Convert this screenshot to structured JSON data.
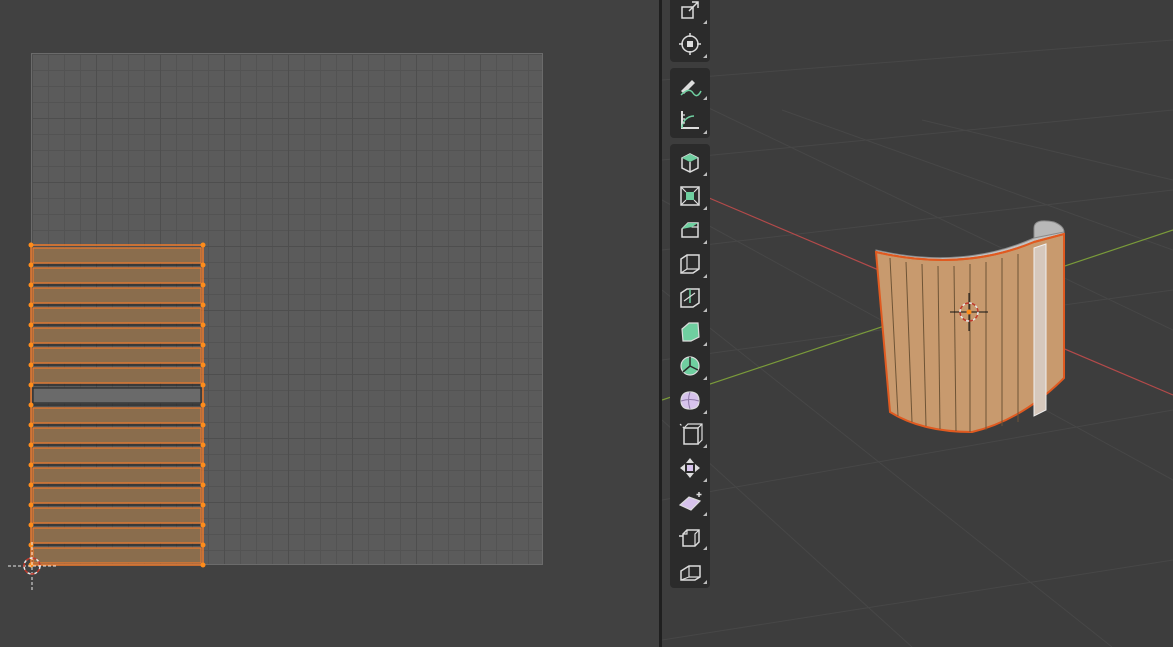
{
  "uv_editor": {
    "island_rows": 16,
    "selected_row_index": 7,
    "colors": {
      "background": "#414141",
      "grid": "#5b5b5b",
      "face": "#8a6d4d",
      "unselected_face": "#6a6a6a",
      "edge": "#f07a2a",
      "vertex": "#ff8c1a"
    }
  },
  "viewport": {
    "colors": {
      "background": "#3d3d3d",
      "x_axis": "#b34a4a",
      "y_axis": "#7a9b3a",
      "mesh_face": "#c89a6e",
      "selection_outline": "#e05a20"
    },
    "toolbar_groups": [
      [
        {
          "name": "scale-tool-icon",
          "glyph": "scale"
        },
        {
          "name": "transform-tool-icon",
          "glyph": "transform"
        }
      ],
      [
        {
          "name": "annotate-tool-icon",
          "glyph": "annotate"
        },
        {
          "name": "measure-tool-icon",
          "glyph": "measure"
        }
      ],
      [
        {
          "name": "add-cube-tool-icon",
          "glyph": "add-cube"
        },
        {
          "name": "extrude-region-tool-icon",
          "glyph": "extrude"
        },
        {
          "name": "inset-faces-tool-icon",
          "glyph": "inset"
        },
        {
          "name": "bevel-tool-icon",
          "glyph": "bevel"
        },
        {
          "name": "loop-cut-tool-icon",
          "glyph": "loopcut"
        },
        {
          "name": "knife-tool-icon",
          "glyph": "knife"
        },
        {
          "name": "poly-build-tool-icon",
          "glyph": "polybuild"
        },
        {
          "name": "spin-tool-icon",
          "glyph": "spin"
        },
        {
          "name": "smooth-tool-icon",
          "glyph": "smooth"
        },
        {
          "name": "edge-slide-tool-icon",
          "glyph": "edgeslide"
        },
        {
          "name": "shrink-fatten-tool-icon",
          "glyph": "shrink"
        },
        {
          "name": "shear-tool-icon",
          "glyph": "shear"
        },
        {
          "name": "rip-region-tool-icon",
          "glyph": "rip"
        }
      ]
    ]
  }
}
